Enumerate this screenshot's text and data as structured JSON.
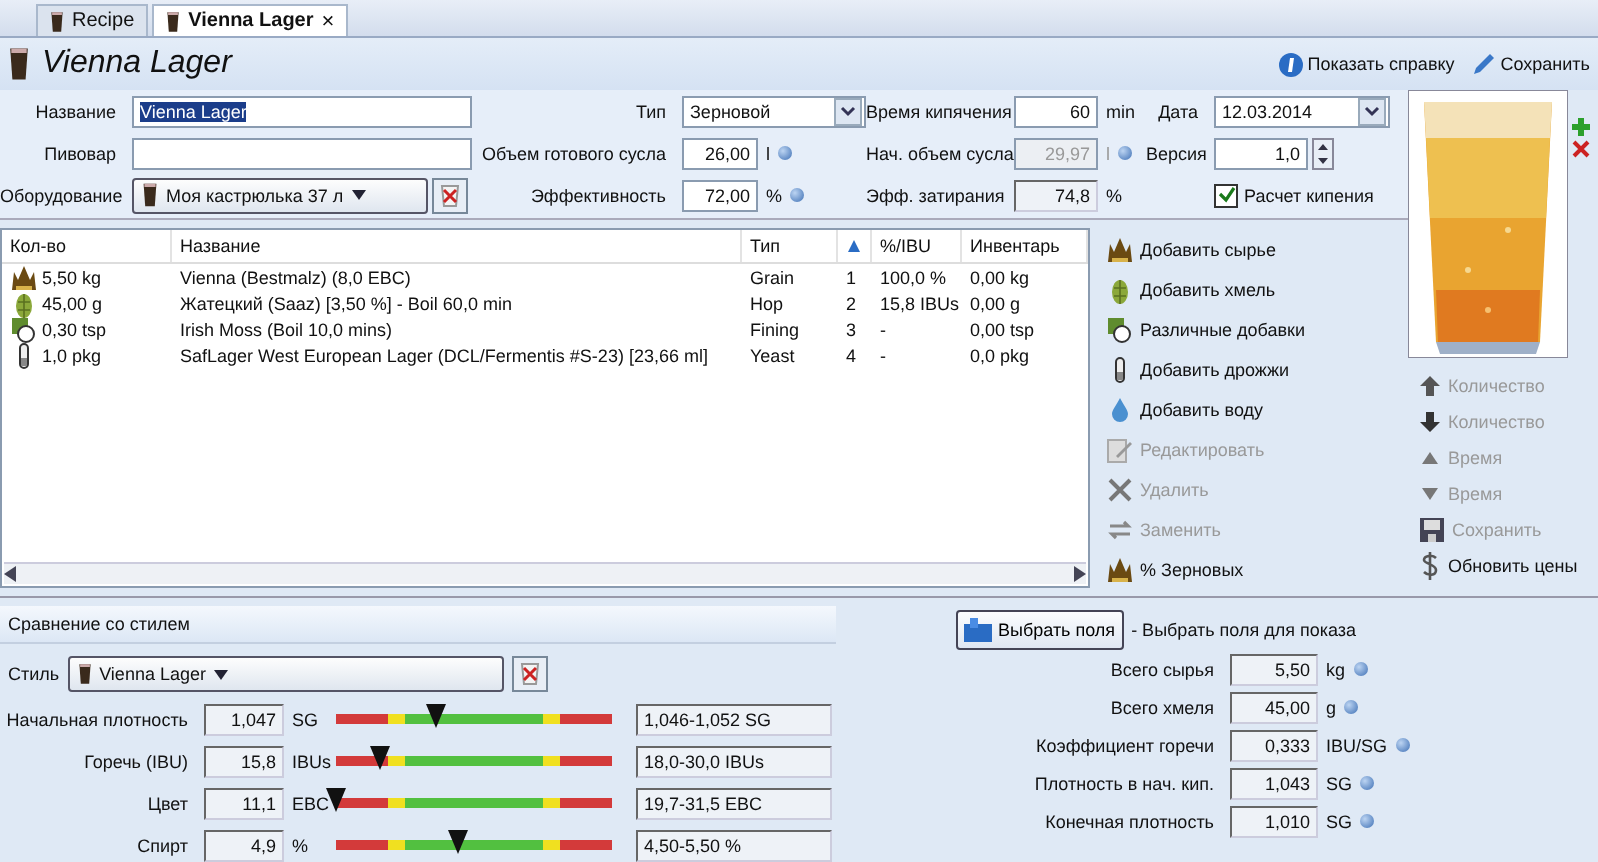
{
  "tabs": [
    {
      "label": "Recipe",
      "selected": false
    },
    {
      "label": "Vienna Lager",
      "selected": true,
      "close": "×"
    }
  ],
  "header": {
    "title": "Vienna Lager",
    "links": [
      {
        "kind": "help",
        "label": "Показать справку"
      },
      {
        "kind": "save",
        "label": "Сохранить"
      }
    ]
  },
  "form": {
    "name": {
      "label": "Название",
      "value": "Vienna Lager"
    },
    "brewer": {
      "label": "Пивовар"
    },
    "equipment": {
      "label": "Оборудование",
      "value": "Моя кастрюлька 37 л"
    },
    "type": {
      "label": "Тип",
      "value": "Зерновой"
    },
    "batch_size": {
      "label": "Объем готового сусла",
      "value": "26,00",
      "unit": "l"
    },
    "efficiency": {
      "label": "Эффективность",
      "value": "72,00",
      "unit": "%"
    },
    "boil_time": {
      "label": "Время кипячения",
      "value": "60",
      "unit": "min"
    },
    "boil_size": {
      "label": "Нач. объем сусла",
      "value": "29,97",
      "unit": "l",
      "disabled": true
    },
    "mash_efficiency": {
      "label": "Эфф. затирания",
      "value": "74,8",
      "unit": "%"
    },
    "date": {
      "label": "Дата",
      "value": "12.03.2014"
    },
    "version": {
      "label": "Версия",
      "value": "1,0"
    },
    "calc_boil": {
      "label": "Расчет кипения",
      "checked": true
    }
  },
  "ingredients": {
    "columns": [
      "Кол-во",
      "Название",
      "Тип",
      "%/IBU",
      "Инвентарь"
    ],
    "rows": [
      {
        "kind": "grain",
        "amount": "5,50 kg",
        "name": "Vienna (Bestmalz) (8,0 EBC)",
        "type": "Grain",
        "order": "1",
        "percent": "100,0 %",
        "inventory": "0,00 kg"
      },
      {
        "kind": "hop",
        "amount": "45,00 g",
        "name": "Жатецкий (Saaz) [3,50 %] - Boil 60,0 min",
        "type": "Hop",
        "order": "2",
        "percent": "15,8 IBUs",
        "inventory": "0,00 g"
      },
      {
        "kind": "misc",
        "amount": "0,30 tsp",
        "name": "Irish Moss (Boil 10,0 mins)",
        "type": "Fining",
        "order": "3",
        "percent": "-",
        "inventory": "0,00 tsp"
      },
      {
        "kind": "yeast",
        "amount": "1,0 pkg",
        "name": "SafLager West European Lager (DCL/Fermentis #S-23) [23,66 ml]",
        "type": "Yeast",
        "order": "4",
        "percent": "-",
        "inventory": "0,0 pkg"
      }
    ]
  },
  "actions": [
    {
      "kind": "grain",
      "label": "Добавить сырье",
      "disabled": false
    },
    {
      "kind": "hop",
      "label": "Добавить хмель",
      "disabled": false
    },
    {
      "kind": "misc",
      "label": "Различные добавки",
      "disabled": false
    },
    {
      "kind": "yeast",
      "label": "Добавить дрожжи",
      "disabled": false
    },
    {
      "kind": "water",
      "label": "Добавить воду",
      "disabled": false
    },
    {
      "kind": "edit",
      "label": "Редактировать",
      "disabled": true
    },
    {
      "kind": "delete",
      "label": "Удалить",
      "disabled": true
    },
    {
      "kind": "replace",
      "label": "Заменить",
      "disabled": true
    },
    {
      "kind": "grain",
      "label": "% Зерновых",
      "disabled": false
    }
  ],
  "order_actions": [
    {
      "kind": "up",
      "label": "Количество",
      "disabled": true
    },
    {
      "kind": "down",
      "label": "Количество",
      "disabled": true
    },
    {
      "kind": "up-small",
      "label": "Время",
      "disabled": true
    },
    {
      "kind": "down-small",
      "label": "Время",
      "disabled": true
    },
    {
      "kind": "save",
      "label": "Сохранить",
      "disabled": true
    },
    {
      "kind": "dollar",
      "label": "Обновить цены",
      "disabled": false
    }
  ],
  "style_comparison": {
    "title": "Сравнение со стилем",
    "style_label": "Стиль",
    "style": "Vienna Lager",
    "metrics": [
      {
        "label": "Начальная плотность",
        "value": "1,047",
        "unit": "SG",
        "level": 0.36,
        "range": "1,046-1,052 SG"
      },
      {
        "label": "Горечь (IBU)",
        "value": "15,8",
        "unit": "IBUs",
        "level": 0.16,
        "range": "18,0-30,0 IBUs"
      },
      {
        "label": "Цвет",
        "value": "11,1",
        "unit": "EBC",
        "level": 0.0,
        "range": "19,7-31,5 EBC"
      },
      {
        "label": "Спирт",
        "value": "4,9",
        "unit": "%",
        "level": 0.44,
        "range": "4,50-5,50 %"
      }
    ]
  },
  "stats": {
    "button": "Выбрать поля",
    "hint": "- Выбрать поля для показа",
    "rows": [
      {
        "label": "Всего сырья",
        "value": "5,50",
        "unit": "kg"
      },
      {
        "label": "Всего хмеля",
        "value": "45,00",
        "unit": "g"
      },
      {
        "label": "Коэффициент горечи",
        "value": "0,333",
        "unit": "IBU/SG"
      },
      {
        "label": "Плотность в нач. кип.",
        "value": "1,043",
        "unit": "SG"
      },
      {
        "label": "Конечная плотность",
        "value": "1,010",
        "unit": "SG"
      }
    ]
  }
}
